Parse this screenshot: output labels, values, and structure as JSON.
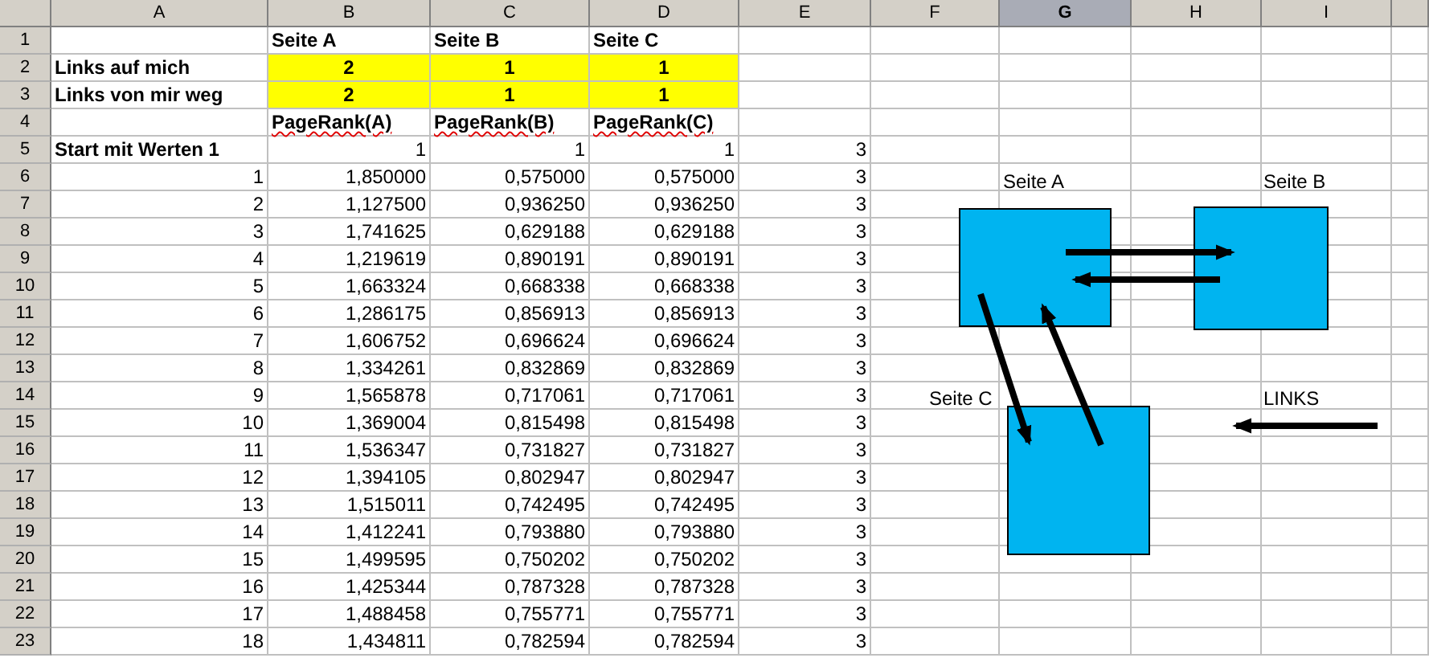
{
  "columns": [
    {
      "label": "A",
      "selected": false
    },
    {
      "label": "B",
      "selected": false
    },
    {
      "label": "C",
      "selected": false
    },
    {
      "label": "D",
      "selected": false
    },
    {
      "label": "E",
      "selected": false
    },
    {
      "label": "F",
      "selected": false
    },
    {
      "label": "G",
      "selected": true
    },
    {
      "label": "H",
      "selected": false
    },
    {
      "label": "I",
      "selected": false
    }
  ],
  "rows": [
    {
      "number": "1",
      "cells": [
        null,
        {
          "text": "Seite A",
          "kind": "label"
        },
        {
          "text": "Seite B",
          "kind": "label"
        },
        {
          "text": "Seite C",
          "kind": "label"
        },
        null
      ]
    },
    {
      "number": "2",
      "cells": [
        {
          "text": "Links auf mich",
          "kind": "label"
        },
        {
          "text": "2",
          "kind": "count"
        },
        {
          "text": "1",
          "kind": "count"
        },
        {
          "text": "1",
          "kind": "count"
        },
        null
      ]
    },
    {
      "number": "3",
      "cells": [
        {
          "text": "Links von mir weg",
          "kind": "label"
        },
        {
          "text": "2",
          "kind": "count"
        },
        {
          "text": "1",
          "kind": "count"
        },
        {
          "text": "1",
          "kind": "count"
        },
        null
      ]
    },
    {
      "number": "4",
      "cells": [
        null,
        {
          "text": "PageRank(A)",
          "kind": "label",
          "misspelled": true
        },
        {
          "text": "PageRank(B)",
          "kind": "label",
          "misspelled": true
        },
        {
          "text": "PageRank(C)",
          "kind": "label",
          "misspelled": true
        },
        null
      ]
    },
    {
      "number": "5",
      "cells": [
        {
          "text": "Start mit Werten 1",
          "kind": "label"
        },
        {
          "text": "1",
          "kind": "number"
        },
        {
          "text": "1",
          "kind": "number"
        },
        {
          "text": "1",
          "kind": "number"
        },
        {
          "text": "3",
          "kind": "number"
        }
      ]
    },
    {
      "number": "6",
      "cells": [
        {
          "text": "1",
          "kind": "number"
        },
        {
          "text": "1,850000",
          "kind": "number"
        },
        {
          "text": "0,575000",
          "kind": "number"
        },
        {
          "text": "0,575000",
          "kind": "number"
        },
        {
          "text": "3",
          "kind": "number"
        }
      ]
    },
    {
      "number": "7",
      "cells": [
        {
          "text": "2",
          "kind": "number"
        },
        {
          "text": "1,127500",
          "kind": "number"
        },
        {
          "text": "0,936250",
          "kind": "number"
        },
        {
          "text": "0,936250",
          "kind": "number"
        },
        {
          "text": "3",
          "kind": "number"
        }
      ]
    },
    {
      "number": "8",
      "cells": [
        {
          "text": "3",
          "kind": "number"
        },
        {
          "text": "1,741625",
          "kind": "number"
        },
        {
          "text": "0,629188",
          "kind": "number"
        },
        {
          "text": "0,629188",
          "kind": "number"
        },
        {
          "text": "3",
          "kind": "number"
        }
      ]
    },
    {
      "number": "9",
      "cells": [
        {
          "text": "4",
          "kind": "number"
        },
        {
          "text": "1,219619",
          "kind": "number"
        },
        {
          "text": "0,890191",
          "kind": "number"
        },
        {
          "text": "0,890191",
          "kind": "number"
        },
        {
          "text": "3",
          "kind": "number"
        }
      ]
    },
    {
      "number": "10",
      "cells": [
        {
          "text": "5",
          "kind": "number"
        },
        {
          "text": "1,663324",
          "kind": "number"
        },
        {
          "text": "0,668338",
          "kind": "number"
        },
        {
          "text": "0,668338",
          "kind": "number"
        },
        {
          "text": "3",
          "kind": "number"
        }
      ]
    },
    {
      "number": "11",
      "cells": [
        {
          "text": "6",
          "kind": "number"
        },
        {
          "text": "1,286175",
          "kind": "number"
        },
        {
          "text": "0,856913",
          "kind": "number"
        },
        {
          "text": "0,856913",
          "kind": "number"
        },
        {
          "text": "3",
          "kind": "number"
        }
      ]
    },
    {
      "number": "12",
      "cells": [
        {
          "text": "7",
          "kind": "number"
        },
        {
          "text": "1,606752",
          "kind": "number"
        },
        {
          "text": "0,696624",
          "kind": "number"
        },
        {
          "text": "0,696624",
          "kind": "number"
        },
        {
          "text": "3",
          "kind": "number"
        }
      ]
    },
    {
      "number": "13",
      "cells": [
        {
          "text": "8",
          "kind": "number"
        },
        {
          "text": "1,334261",
          "kind": "number"
        },
        {
          "text": "0,832869",
          "kind": "number"
        },
        {
          "text": "0,832869",
          "kind": "number"
        },
        {
          "text": "3",
          "kind": "number"
        }
      ]
    },
    {
      "number": "14",
      "cells": [
        {
          "text": "9",
          "kind": "number"
        },
        {
          "text": "1,565878",
          "kind": "number"
        },
        {
          "text": "0,717061",
          "kind": "number"
        },
        {
          "text": "0,717061",
          "kind": "number"
        },
        {
          "text": "3",
          "kind": "number"
        }
      ]
    },
    {
      "number": "15",
      "cells": [
        {
          "text": "10",
          "kind": "number"
        },
        {
          "text": "1,369004",
          "kind": "number"
        },
        {
          "text": "0,815498",
          "kind": "number"
        },
        {
          "text": "0,815498",
          "kind": "number"
        },
        {
          "text": "3",
          "kind": "number"
        }
      ]
    },
    {
      "number": "16",
      "cells": [
        {
          "text": "11",
          "kind": "number"
        },
        {
          "text": "1,536347",
          "kind": "number"
        },
        {
          "text": "0,731827",
          "kind": "number"
        },
        {
          "text": "0,731827",
          "kind": "number"
        },
        {
          "text": "3",
          "kind": "number"
        }
      ]
    },
    {
      "number": "17",
      "cells": [
        {
          "text": "12",
          "kind": "number"
        },
        {
          "text": "1,394105",
          "kind": "number"
        },
        {
          "text": "0,802947",
          "kind": "number"
        },
        {
          "text": "0,802947",
          "kind": "number"
        },
        {
          "text": "3",
          "kind": "number"
        }
      ]
    },
    {
      "number": "18",
      "cells": [
        {
          "text": "13",
          "kind": "number"
        },
        {
          "text": "1,515011",
          "kind": "number"
        },
        {
          "text": "0,742495",
          "kind": "number"
        },
        {
          "text": "0,742495",
          "kind": "number"
        },
        {
          "text": "3",
          "kind": "number"
        }
      ]
    },
    {
      "number": "19",
      "cells": [
        {
          "text": "14",
          "kind": "number"
        },
        {
          "text": "1,412241",
          "kind": "number"
        },
        {
          "text": "0,793880",
          "kind": "number"
        },
        {
          "text": "0,793880",
          "kind": "number"
        },
        {
          "text": "3",
          "kind": "number"
        }
      ]
    },
    {
      "number": "20",
      "cells": [
        {
          "text": "15",
          "kind": "number"
        },
        {
          "text": "1,499595",
          "kind": "number"
        },
        {
          "text": "0,750202",
          "kind": "number"
        },
        {
          "text": "0,750202",
          "kind": "number"
        },
        {
          "text": "3",
          "kind": "number"
        }
      ]
    },
    {
      "number": "21",
      "cells": [
        {
          "text": "16",
          "kind": "number"
        },
        {
          "text": "1,425344",
          "kind": "number"
        },
        {
          "text": "0,787328",
          "kind": "number"
        },
        {
          "text": "0,787328",
          "kind": "number"
        },
        {
          "text": "3",
          "kind": "number"
        }
      ]
    },
    {
      "number": "22",
      "cells": [
        {
          "text": "17",
          "kind": "number"
        },
        {
          "text": "1,488458",
          "kind": "number"
        },
        {
          "text": "0,755771",
          "kind": "number"
        },
        {
          "text": "0,755771",
          "kind": "number"
        },
        {
          "text": "3",
          "kind": "number"
        }
      ]
    },
    {
      "number": "23",
      "cells": [
        {
          "text": "18",
          "kind": "number"
        },
        {
          "text": "1,434811",
          "kind": "number"
        },
        {
          "text": "0,782594",
          "kind": "number"
        },
        {
          "text": "0,782594",
          "kind": "number"
        },
        {
          "text": "3",
          "kind": "number"
        }
      ]
    }
  ],
  "diagram": {
    "nodes": [
      {
        "label": "Seite A"
      },
      {
        "label": "Seite B"
      },
      {
        "label": "Seite C"
      }
    ],
    "legend": {
      "label": "LINKS"
    }
  }
}
